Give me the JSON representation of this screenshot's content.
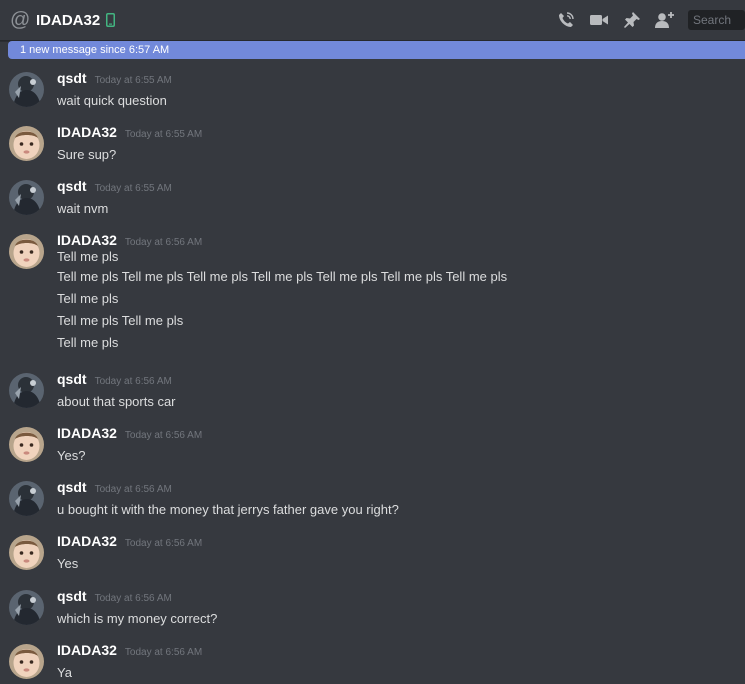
{
  "header": {
    "title": "IDADA32",
    "search_placeholder": "Search"
  },
  "unread_divider": "1 new message since 6:57 AM",
  "messages": [
    {
      "author": "qsdt",
      "time": "Today at 6:55 AM",
      "lines": [
        "wait quick question"
      ],
      "avatar": "qsdt-avatar"
    },
    {
      "author": "IDADA32",
      "time": "Today at 6:55 AM",
      "lines": [
        "Sure sup?"
      ],
      "avatar": "baby-avatar"
    },
    {
      "author": "qsdt",
      "time": "Today at 6:55 AM",
      "lines": [
        "wait nvm"
      ],
      "avatar": "qsdt-avatar"
    },
    {
      "author": "IDADA32",
      "time": "Today at 6:56 AM",
      "lines": [
        "Tell me pls",
        "Tell me pls Tell me pls Tell me pls Tell me pls Tell me pls Tell me pls Tell me pls",
        "Tell me pls",
        "Tell me pls Tell me pls",
        "Tell me pls"
      ],
      "avatar": "baby-avatar"
    },
    {
      "author": "qsdt",
      "time": "Today at 6:56 AM",
      "lines": [
        "about that sports car"
      ],
      "avatar": "qsdt-avatar"
    },
    {
      "author": "IDADA32",
      "time": "Today at 6:56 AM",
      "lines": [
        "Yes?"
      ],
      "avatar": "baby-avatar"
    },
    {
      "author": "qsdt",
      "time": "Today at 6:56 AM",
      "lines": [
        "u bought it with the money that jerrys father gave you right?"
      ],
      "avatar": "qsdt-avatar"
    },
    {
      "author": "IDADA32",
      "time": "Today at 6:56 AM",
      "lines": [
        "Yes"
      ],
      "avatar": "baby-avatar"
    },
    {
      "author": "qsdt",
      "time": "Today at 6:56 AM",
      "lines": [
        "which is my money correct?"
      ],
      "avatar": "qsdt-avatar"
    },
    {
      "author": "IDADA32",
      "time": "Today at 6:56 AM",
      "lines": [
        "Ya"
      ],
      "avatar": "baby-avatar"
    }
  ],
  "colors": {
    "background": "#36393f",
    "divider": "#7289da",
    "mobile_status": "#43b581"
  }
}
